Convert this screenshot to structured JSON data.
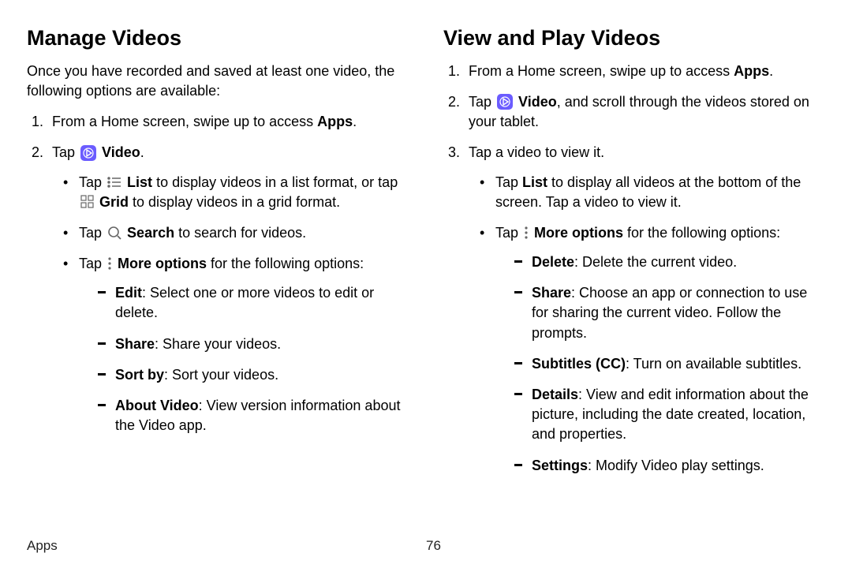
{
  "footer": {
    "section": "Apps",
    "page": "76"
  },
  "left": {
    "heading": "Manage Videos",
    "intro": "Once you have recorded and saved at least one video, the following options are available:",
    "step1_a": "From a Home screen, swipe up to access ",
    "step1_b": "Apps",
    "step1_c": ".",
    "step2_a": "Tap ",
    "step2_b": "Video",
    "step2_c": ".",
    "b1_a": "Tap ",
    "b1_b": "List",
    "b1_c": " to display videos in a list format, or tap ",
    "b1_d": "Grid",
    "b1_e": " to display videos in a grid format.",
    "b2_a": "Tap ",
    "b2_b": "Search",
    "b2_c": " to search for videos.",
    "b3_a": "Tap ",
    "b3_b": "More options",
    "b3_c": " for the following options:",
    "d1_a": "Edit",
    "d1_b": ": Select one or more videos to edit or delete.",
    "d2_a": "Share",
    "d2_b": ": Share your videos.",
    "d3_a": "Sort by",
    "d3_b": ": Sort your videos.",
    "d4_a": "About Video",
    "d4_b": ": View version information about the Video app."
  },
  "right": {
    "heading": "View and Play Videos",
    "step1_a": "From a Home screen, swipe up to access ",
    "step1_b": "Apps",
    "step1_c": ".",
    "step2_a": "Tap ",
    "step2_b": "Video",
    "step2_c": ", and scroll through the videos stored on your tablet.",
    "step3": "Tap a video to view it.",
    "b1_a": "Tap ",
    "b1_b": "List",
    "b1_c": " to display all videos at the bottom of the screen. Tap a video to view it.",
    "b2_a": "Tap ",
    "b2_b": "More options",
    "b2_c": " for the following options:",
    "d1_a": "Delete",
    "d1_b": ": Delete the current video.",
    "d2_a": "Share",
    "d2_b": ": Choose an app or connection to use for sharing the current video. Follow the prompts.",
    "d3_a": "Subtitles (CC)",
    "d3_b": ": Turn on available subtitles.",
    "d4_a": "Details",
    "d4_b": ": View and edit information about the picture, including the date created, location, and properties.",
    "d5_a": "Settings",
    "d5_b": ": Modify Video play settings."
  }
}
